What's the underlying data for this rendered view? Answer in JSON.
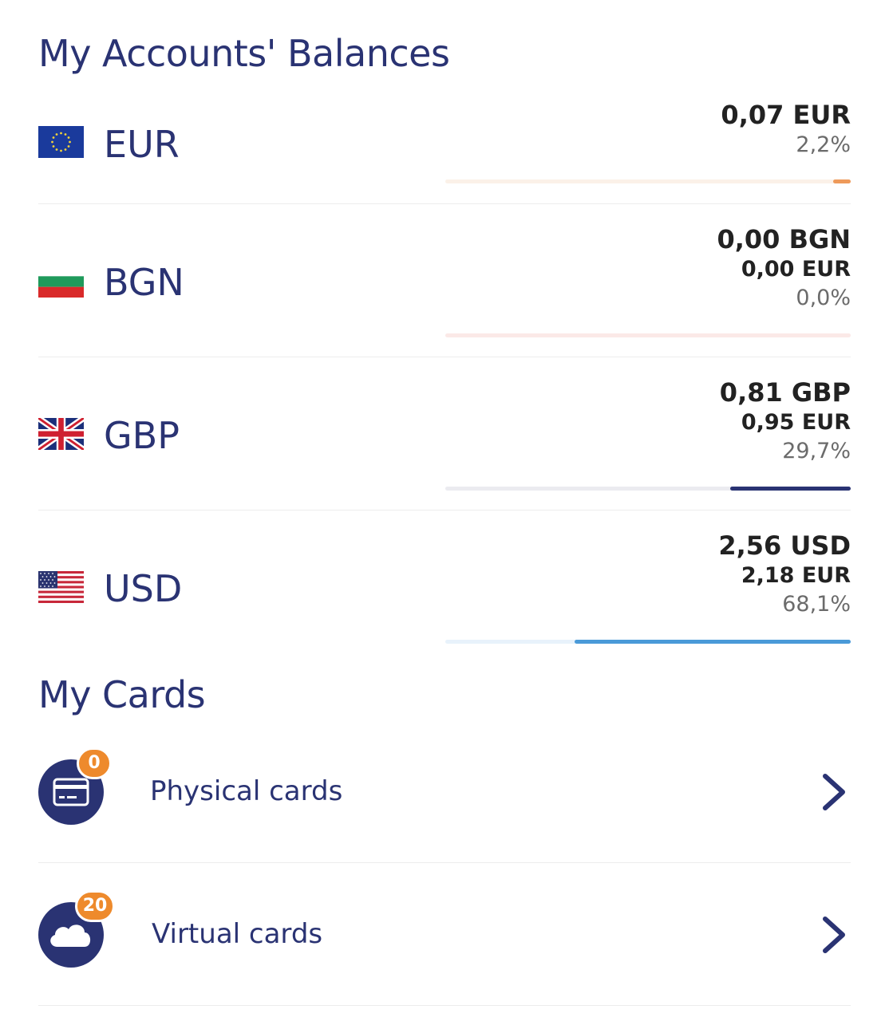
{
  "balances": {
    "title": "My Accounts' Balances",
    "accounts": [
      {
        "currency": "EUR",
        "amount": "0,07 EUR",
        "eur_equivalent": "",
        "share": "2,2%",
        "share_value": 0.022,
        "bar_color": "#ee9a5a",
        "track_color": "#fbf1e8",
        "flag": "eu-flag-icon"
      },
      {
        "currency": "BGN",
        "amount": "0,00 BGN",
        "eur_equivalent": "0,00 EUR",
        "share": "0,0%",
        "share_value": 0.0,
        "bar_color": "#e06a6a",
        "track_color": "#fbe9e7",
        "flag": "bulgaria-flag-icon"
      },
      {
        "currency": "GBP",
        "amount": "0,81 GBP",
        "eur_equivalent": "0,95 EUR",
        "share": "29,7%",
        "share_value": 0.297,
        "bar_color": "#2a3373",
        "track_color": "#ebebf0",
        "flag": "uk-flag-icon"
      },
      {
        "currency": "USD",
        "amount": "2,56 USD",
        "eur_equivalent": "2,18 EUR",
        "share": "68,1%",
        "share_value": 0.681,
        "bar_color": "#4a9ad8",
        "track_color": "#e8f2fb",
        "flag": "usa-flag-icon"
      }
    ]
  },
  "cards": {
    "title": "My Cards",
    "items": [
      {
        "label": "Physical cards",
        "count": "0",
        "icon": "credit-card-icon"
      },
      {
        "label": "Virtual cards",
        "count": "20",
        "icon": "cloud-icon"
      }
    ]
  },
  "colors": {
    "primary": "#2a3373",
    "badge": "#ee8a2c",
    "text": "#222222",
    "muted": "#6b6b6b"
  }
}
